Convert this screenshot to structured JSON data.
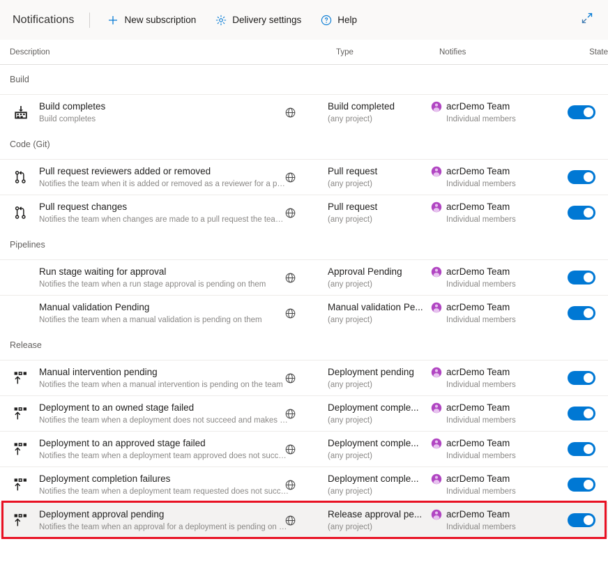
{
  "commandbar": {
    "title": "Notifications",
    "buttons": [
      {
        "label": "New subscription",
        "icon": "plus-icon"
      },
      {
        "label": "Delivery settings",
        "icon": "gear-icon"
      },
      {
        "label": "Help",
        "icon": "question-circle-icon"
      }
    ],
    "expand": {
      "icon": "expand-diagonal-icon"
    }
  },
  "table": {
    "columns": {
      "description": "Description",
      "type": "Type",
      "notifies": "Notifies",
      "state": "State"
    }
  },
  "colors": {
    "accent": "#0078d4",
    "toggle_on": "#0078d4",
    "highlight_border": "#e81123",
    "team_avatar": "#b146c2",
    "subtext": "#8a8886",
    "row_divider": "#edebe9",
    "commandbar_bg": "#faf9f8"
  },
  "groups": [
    {
      "name": "Build",
      "rows": [
        {
          "icon": "build-icon",
          "title": "Build completes",
          "subtitle": "Build completes",
          "scope_icon": "globe-icon",
          "type": "Build completed",
          "type_scope": "(any project)",
          "notifies_name": "acrDemo Team",
          "notifies_sub": "Individual members",
          "notifies_icon": "team-avatar-icon",
          "state": "on",
          "highlighted": false
        }
      ]
    },
    {
      "name": "Code (Git)",
      "rows": [
        {
          "icon": "pull-request-icon",
          "title": "Pull request reviewers added or removed",
          "subtitle": "Notifies the team when it is added or removed as a reviewer for a pull requ...",
          "scope_icon": "globe-icon",
          "type": "Pull request",
          "type_scope": "(any project)",
          "notifies_name": "acrDemo Team",
          "notifies_sub": "Individual members",
          "notifies_icon": "team-avatar-icon",
          "state": "on",
          "highlighted": false
        },
        {
          "icon": "pull-request-icon",
          "title": "Pull request changes",
          "subtitle": "Notifies the team when changes are made to a pull request the team is a r...",
          "scope_icon": "globe-icon",
          "type": "Pull request",
          "type_scope": "(any project)",
          "notifies_name": "acrDemo Team",
          "notifies_sub": "Individual members",
          "notifies_icon": "team-avatar-icon",
          "state": "on",
          "highlighted": false
        }
      ]
    },
    {
      "name": "Pipelines",
      "rows": [
        {
          "icon": "none",
          "title": "Run stage waiting for approval",
          "subtitle": "Notifies the team when a run stage approval is pending on them",
          "scope_icon": "globe-icon",
          "type": "Approval Pending",
          "type_scope": "(any project)",
          "notifies_name": "acrDemo Team",
          "notifies_sub": "Individual members",
          "notifies_icon": "team-avatar-icon",
          "state": "on",
          "highlighted": false
        },
        {
          "icon": "none",
          "title": "Manual validation Pending",
          "subtitle": "Notifies the team when a manual validation is pending on them",
          "scope_icon": "globe-icon",
          "type": "Manual validation Pe...",
          "type_scope": "(any project)",
          "notifies_name": "acrDemo Team",
          "notifies_sub": "Individual members",
          "notifies_icon": "team-avatar-icon",
          "state": "on",
          "highlighted": false
        }
      ]
    },
    {
      "name": "Release",
      "rows": [
        {
          "icon": "release-icon",
          "title": "Manual intervention pending",
          "subtitle": "Notifies the team when a manual intervention is pending on the team",
          "scope_icon": "globe-icon",
          "type": "Deployment pending",
          "type_scope": "(any project)",
          "notifies_name": "acrDemo Team",
          "notifies_sub": "Individual members",
          "notifies_icon": "team-avatar-icon",
          "state": "on",
          "highlighted": false
        },
        {
          "icon": "release-icon",
          "title": "Deployment to an owned stage failed",
          "subtitle": "Notifies the team when a deployment does not succeed and makes a stag...",
          "scope_icon": "globe-icon",
          "type": "Deployment comple...",
          "type_scope": "(any project)",
          "notifies_name": "acrDemo Team",
          "notifies_sub": "Individual members",
          "notifies_icon": "team-avatar-icon",
          "state": "on",
          "highlighted": false
        },
        {
          "icon": "release-icon",
          "title": "Deployment to an approved stage failed",
          "subtitle": "Notifies the team when a deployment team approved does not succeed an...",
          "scope_icon": "globe-icon",
          "type": "Deployment comple...",
          "type_scope": "(any project)",
          "notifies_name": "acrDemo Team",
          "notifies_sub": "Individual members",
          "notifies_icon": "team-avatar-icon",
          "state": "on",
          "highlighted": false
        },
        {
          "icon": "release-icon",
          "title": "Deployment completion failures",
          "subtitle": "Notifies the team when a deployment team requested does not succeed a...",
          "scope_icon": "globe-icon",
          "type": "Deployment comple...",
          "type_scope": "(any project)",
          "notifies_name": "acrDemo Team",
          "notifies_sub": "Individual members",
          "notifies_icon": "team-avatar-icon",
          "state": "on",
          "highlighted": false
        },
        {
          "icon": "release-icon",
          "title": "Deployment approval pending",
          "subtitle": "Notifies the team when an approval for a deployment is pending on the te...",
          "scope_icon": "globe-icon",
          "type": "Release approval pe...",
          "type_scope": "(any project)",
          "notifies_name": "acrDemo Team",
          "notifies_sub": "Individual members",
          "notifies_icon": "team-avatar-icon",
          "state": "on",
          "highlighted": true
        }
      ]
    }
  ]
}
